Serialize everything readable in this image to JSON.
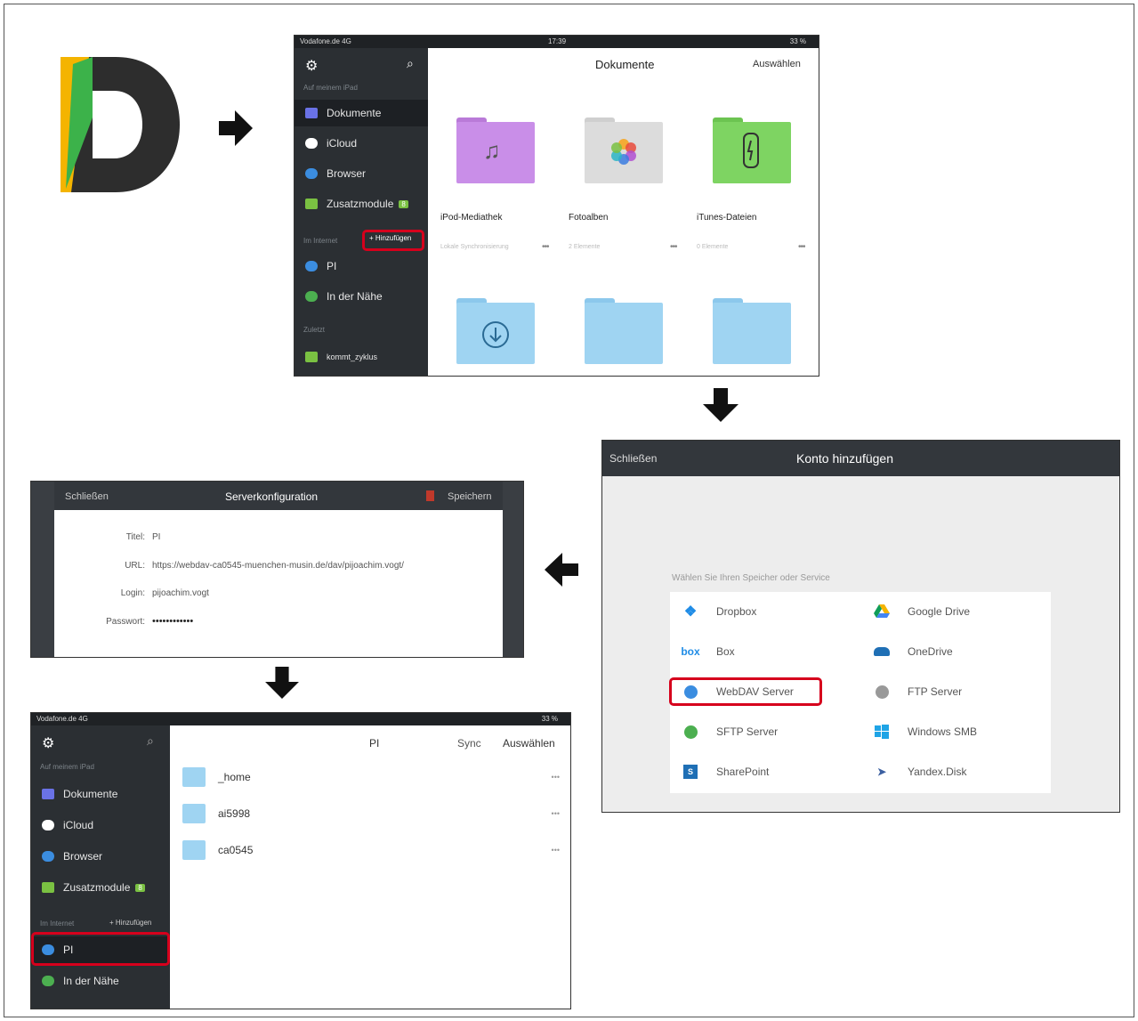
{
  "app": {
    "logo_letter": "D"
  },
  "screen1": {
    "status": {
      "carrier": "Vodafone.de  4G",
      "time": "17:39",
      "battery": "33 %"
    },
    "sidebar": {
      "section_device": "Auf meinem iPad",
      "items": [
        {
          "label": "Dokumente",
          "icon": "folder-icon",
          "color": "#6a72e6"
        },
        {
          "label": "iCloud",
          "icon": "cloud-icon",
          "color": "#ffffff"
        },
        {
          "label": "Browser",
          "icon": "compass-icon",
          "color": "#3b8de0"
        },
        {
          "label": "Zusatzmodule",
          "icon": "cart-icon",
          "color": "#7ac142",
          "badge": "8"
        }
      ],
      "section_internet": "Im Internet",
      "add_label": "+ Hinzufügen",
      "internet_items": [
        {
          "label": "PI",
          "icon": "globe-icon",
          "color": "#3b8de0"
        },
        {
          "label": "In der Nähe",
          "icon": "nearby-icon",
          "color": "#4caf50"
        }
      ],
      "section_recent": "Zuletzt",
      "recent_items": [
        {
          "label": "kommt_zyklus",
          "icon": "file-icon",
          "color": "#7ac142"
        }
      ]
    },
    "header": {
      "title": "Dokumente",
      "select": "Auswählen"
    },
    "folders": [
      {
        "label": "iPod-Mediathek",
        "sub": "Lokale Synchronisierung",
        "color": "#c98ee8",
        "icon": "music-icon"
      },
      {
        "label": "Fotoalben",
        "sub": "2 Elemente",
        "color": "#dcdcdc",
        "icon": "photos-icon"
      },
      {
        "label": "iTunes-Dateien",
        "sub": "0 Elemente",
        "color": "#7ed462",
        "icon": "usb-icon"
      }
    ],
    "bottom_folders": [
      {
        "color": "#9fd4f2",
        "icon": "download-icon"
      },
      {
        "color": "#9fd4f2"
      },
      {
        "color": "#9fd4f2"
      }
    ]
  },
  "screen2": {
    "close": "Schließen",
    "title": "Konto hinzufügen",
    "prompt": "Wählen Sie Ihren Speicher oder Service",
    "services_left": [
      {
        "label": "Dropbox",
        "icon": "dropbox-icon",
        "color": "#1f8ce6"
      },
      {
        "label": "Box",
        "icon": "box-icon",
        "color": "#1f8ce6"
      },
      {
        "label": "WebDAV Server",
        "icon": "globe-icon",
        "color": "#3b8de0"
      },
      {
        "label": "SFTP Server",
        "icon": "globe-icon",
        "color": "#4caf50"
      },
      {
        "label": "SharePoint",
        "icon": "sharepoint-icon",
        "color": "#1f6fb5"
      }
    ],
    "services_right": [
      {
        "label": "Google Drive",
        "icon": "google-drive-icon",
        "color": "#f4b400"
      },
      {
        "label": "OneDrive",
        "icon": "onedrive-icon",
        "color": "#1f6fb5"
      },
      {
        "label": "FTP Server",
        "icon": "globe-icon",
        "color": "#888888"
      },
      {
        "label": "Windows SMB",
        "icon": "windows-icon",
        "color": "#1fa4e6"
      },
      {
        "label": "Yandex.Disk",
        "icon": "yandex-icon",
        "color": "#3b5fa0"
      }
    ]
  },
  "screen3": {
    "close": "Schließen",
    "title": "Serverkonfiguration",
    "save": "Speichern",
    "fields": [
      {
        "label": "Titel:",
        "value": "PI"
      },
      {
        "label": "URL:",
        "value": "https://webdav-ca0545-muenchen-musin.de/dav/pijoachim.vogt/"
      },
      {
        "label": "Login:",
        "value": "pijoachim.vogt"
      },
      {
        "label": "Passwort:",
        "value": "••••••••••••"
      }
    ]
  },
  "screen4": {
    "status": {
      "carrier": "Vodafone.de  4G",
      "battery": "33 %"
    },
    "sidebar": {
      "section_device": "Auf meinem iPad",
      "items": [
        {
          "label": "Dokumente",
          "color": "#6a72e6"
        },
        {
          "label": "iCloud",
          "color": "#ffffff"
        },
        {
          "label": "Browser",
          "color": "#3b8de0"
        },
        {
          "label": "Zusatzmodule",
          "color": "#7ac142",
          "badge": "8"
        }
      ],
      "section_internet": "Im Internet",
      "add_label": "+ Hinzufügen",
      "internet_items": [
        {
          "label": "PI",
          "color": "#3b8de0"
        },
        {
          "label": "In der Nähe",
          "color": "#4caf50"
        }
      ]
    },
    "header": {
      "title": "PI",
      "sync": "Sync",
      "select": "Auswählen"
    },
    "rows": [
      {
        "label": "_home"
      },
      {
        "label": "ai5998"
      },
      {
        "label": "ca0545"
      }
    ]
  },
  "colors": {
    "highlight": "#d6001c",
    "dark_sidebar": "#2b2f33"
  }
}
